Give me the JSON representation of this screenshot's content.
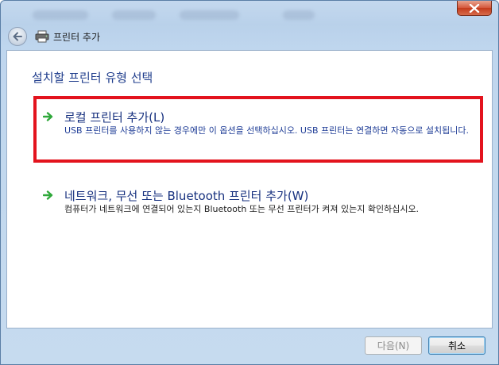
{
  "window": {
    "title": "프린터 추가",
    "close_label": "닫기"
  },
  "page": {
    "heading": "설치할 프린터 유형 선택"
  },
  "options": [
    {
      "title": "로컬 프린터 추가(L)",
      "description": "USB 프린터를 사용하지 않는 경우에만 이 옵션을 선택하십시오. USB 프린터는 연결하면 자동으로 설치됩니다."
    },
    {
      "title": "네트워크, 무선 또는 Bluetooth 프린터 추가(W)",
      "description": "컴퓨터가 네트워크에 연결되어 있는지 Bluetooth 또는 무선 프린터가 켜져 있는지 확인하십시오."
    }
  ],
  "buttons": {
    "next": "다음(N)",
    "cancel": "취소"
  },
  "colors": {
    "highlight": "#e3131d",
    "heading": "#1f3d8c",
    "arrow": "#2fa83a"
  }
}
